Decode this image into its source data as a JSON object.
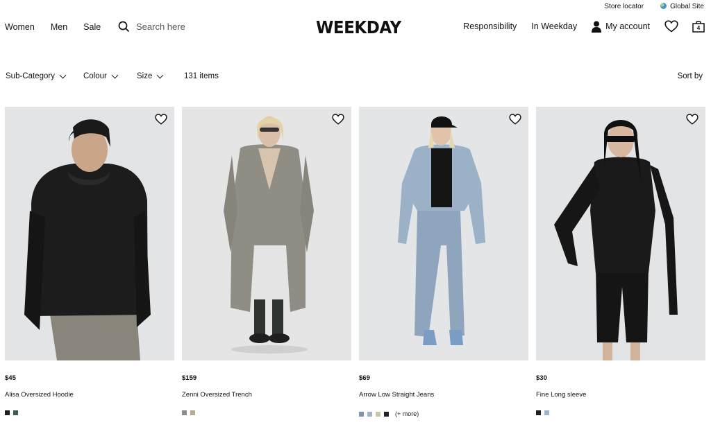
{
  "utility": {
    "store_locator": "Store locator",
    "global_site": "Global Site"
  },
  "nav": {
    "left": [
      "Women",
      "Men",
      "Sale"
    ],
    "search_placeholder": "Search here",
    "logo": "WEEKDAY",
    "responsibility": "Responsibility",
    "in_weekday": "In Weekday",
    "my_account": "My account",
    "bag_count": "4"
  },
  "filters": {
    "sub_category": "Sub-Category",
    "colour": "Colour",
    "size": "Size",
    "items_count": "131 items",
    "sort_by": "Sort by"
  },
  "products": [
    {
      "price": "$45",
      "name": "Alisa Oversized Hoodie",
      "swatches": [
        "#1d1d1d",
        "#3f5a52"
      ],
      "more": "",
      "bg": "#e3e4e6",
      "garment": "#1c1c1c"
    },
    {
      "price": "$159",
      "name": "Zenni Oversized Trench",
      "swatches": [
        "#8a8a86",
        "#b7aa8c"
      ],
      "more": "",
      "bg": "#e5e5e6",
      "garment": "#8f8d84"
    },
    {
      "price": "$69",
      "name": "Arrow Low Straight Jeans",
      "swatches": [
        "#7f93ad",
        "#9fb4c9",
        "#c9c3a8",
        "#222222"
      ],
      "more": "(+ more)",
      "bg": "#e4e5e7",
      "garment": "#8fa5be"
    },
    {
      "price": "$30",
      "name": "Fine Long sleeve",
      "swatches": [
        "#1d1d1d",
        "#9eb2cc"
      ],
      "more": "",
      "bg": "#e3e4e6",
      "garment": "#151515"
    }
  ]
}
